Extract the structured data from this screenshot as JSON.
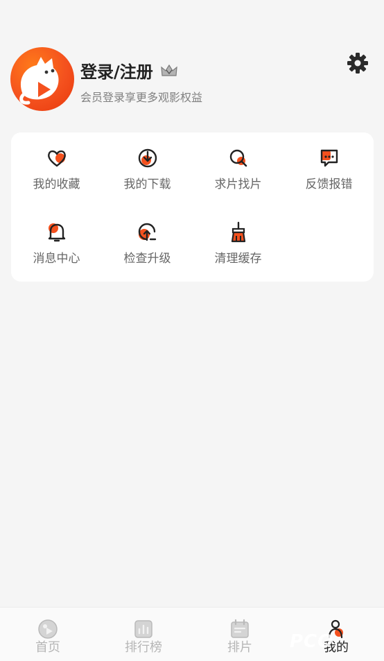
{
  "header": {
    "title": "登录/注册",
    "subtitle": "会员登录享更多观影权益"
  },
  "colors": {
    "accent": "#f4511e",
    "text": "#222222",
    "muted": "#808080"
  },
  "menu": [
    {
      "label": "我的收藏",
      "icon": "heart-icon"
    },
    {
      "label": "我的下载",
      "icon": "download-icon"
    },
    {
      "label": "求片找片",
      "icon": "search-film-icon"
    },
    {
      "label": "反馈报错",
      "icon": "feedback-icon"
    },
    {
      "label": "消息中心",
      "icon": "bell-icon"
    },
    {
      "label": "检查升级",
      "icon": "upgrade-icon"
    },
    {
      "label": "清理缓存",
      "icon": "broom-icon"
    }
  ],
  "tabs": [
    {
      "label": "首页",
      "icon": "home-icon",
      "active": false
    },
    {
      "label": "排行榜",
      "icon": "ranking-icon",
      "active": false
    },
    {
      "label": "排片",
      "icon": "calendar-icon",
      "active": false
    },
    {
      "label": "我的",
      "icon": "profile-icon",
      "active": true
    }
  ],
  "watermark": "PCO"
}
